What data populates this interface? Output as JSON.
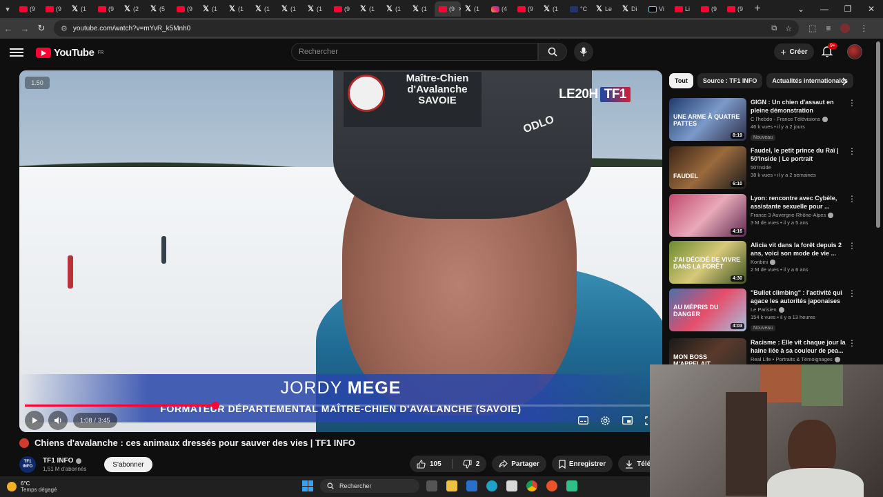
{
  "browser": {
    "tabs": [
      {
        "kind": "yt",
        "label": "(9"
      },
      {
        "kind": "yt",
        "label": "(9"
      },
      {
        "kind": "x",
        "label": "(1"
      },
      {
        "kind": "yt",
        "label": "(9"
      },
      {
        "kind": "x",
        "label": "(2"
      },
      {
        "kind": "x",
        "label": "(5"
      },
      {
        "kind": "yt",
        "label": "(9"
      },
      {
        "kind": "x",
        "label": "(1"
      },
      {
        "kind": "x",
        "label": "(1"
      },
      {
        "kind": "x",
        "label": "(1"
      },
      {
        "kind": "x",
        "label": "(1"
      },
      {
        "kind": "x",
        "label": "(1"
      },
      {
        "kind": "yt",
        "label": "(9"
      },
      {
        "kind": "x",
        "label": "(1"
      },
      {
        "kind": "x",
        "label": "(1"
      },
      {
        "kind": "x",
        "label": "(1"
      },
      {
        "kind": "yt",
        "label": "(9",
        "active": true
      },
      {
        "kind": "x",
        "label": "(1"
      },
      {
        "kind": "ig",
        "label": "(4"
      },
      {
        "kind": "yt",
        "label": "(9"
      },
      {
        "kind": "x",
        "label": "(1"
      },
      {
        "kind": "tv",
        "label": "°C"
      },
      {
        "kind": "x",
        "label": "Le"
      },
      {
        "kind": "x",
        "label": "Di"
      },
      {
        "kind": "tt",
        "label": "Vi"
      },
      {
        "kind": "yt",
        "label": "Li"
      },
      {
        "kind": "yt",
        "label": "(9"
      },
      {
        "kind": "yt",
        "label": "(9"
      }
    ],
    "close_glyph": "✕",
    "new_tab": "+",
    "url": "youtube.com/watch?v=mYvR_k5Mnh0"
  },
  "youtube": {
    "logo_text": "YouTube",
    "region": "FR",
    "search_placeholder": "Rechercher",
    "create_label": "Créer",
    "notif_badge": "9+"
  },
  "player": {
    "speed": "1.50",
    "current_time": "1:08",
    "separator": " / ",
    "duration": "3:45",
    "progress": 0.302,
    "channel_bug": "LE20H",
    "bug_logo": "TF1",
    "beanie_text": "Maître-Chien d'Avalanche SAVOIE",
    "brand_text": "ODLO",
    "lower_third_first": "JORDY ",
    "lower_third_last": "MEGE",
    "lower_third_role": "FORMATEUR DÉPARTEMENTAL MAÎTRE-CHIEN D'AVALANCHE (SAVOIE)"
  },
  "video": {
    "title": "Chiens d'avalanche : ces animaux dressés pour sauver des vies | TF1 INFO",
    "channel": "TF1 INFO",
    "channel_avatar": "TF1 INFO",
    "subscribers": "1,51 M d'abonnés",
    "subscribe_label": "S'abonner",
    "likes": "105",
    "dislikes": "2",
    "share_label": "Partager",
    "save_label": "Enregistrer",
    "download_label": "Télécharger"
  },
  "sidebar": {
    "chips": [
      "Tout",
      "Source : TF1 INFO",
      "Actualités internationales"
    ],
    "recs": [
      {
        "title": "GIGN : Un chien d'assaut en pleine démonstration",
        "channel": "C l'hebdo - France Télévisions",
        "verified": true,
        "stats": "46 k vues • il y a 2 jours",
        "badge": "Nouveau",
        "duration": "8:19",
        "thumb_text": "UNE ARME À QUATRE PATTES"
      },
      {
        "title": "Faudel, le petit prince du Raï | 50'Inside | Le portrait",
        "channel": "50'Inside",
        "verified": false,
        "stats": "38 k vues • il y a 2 semaines",
        "badge": "",
        "duration": "6:10",
        "thumb_text": "FAUDEL"
      },
      {
        "title": "Lyon: rencontre avec Cybèle, assistante sexuelle pour ...",
        "channel": "France 3 Auvergne-Rhône-Alpes",
        "verified": true,
        "stats": "3 M de vues • il y a 5 ans",
        "badge": "",
        "duration": "4:16",
        "thumb_text": ""
      },
      {
        "title": "Alicia vit dans la forêt depuis 2 ans, voici son mode de vie ...",
        "channel": "Konbini",
        "verified": true,
        "stats": "2 M de vues • il y a 6 ans",
        "badge": "",
        "duration": "4:30",
        "thumb_text": "J'AI DÉCIDÉ DE VIVRE DANS LA FORÊT"
      },
      {
        "title": "\"Bullet climbing\" : l'activité qui agace les autorités japonaises",
        "channel": "Le Parisien",
        "verified": true,
        "stats": "154 k vues • il y a 13 heures",
        "badge": "Nouveau",
        "duration": "4:03",
        "thumb_text": "Au mépris du danger"
      },
      {
        "title": "Racisme : Elle vit chaque jour la haine liée à sa couleur de pea...",
        "channel": "Real Life • Portraits & Témoignages",
        "verified": true,
        "stats": "",
        "badge": "",
        "duration": "",
        "thumb_text": "MON BOSS M'APPELAIT"
      }
    ]
  },
  "taskbar": {
    "temp": "6°C",
    "weather": "Temps dégagé",
    "search_label": "Rechercher"
  },
  "colors": {
    "accent": "#ff0033",
    "background": "#0f0f0f",
    "chip_bg": "#272727"
  }
}
